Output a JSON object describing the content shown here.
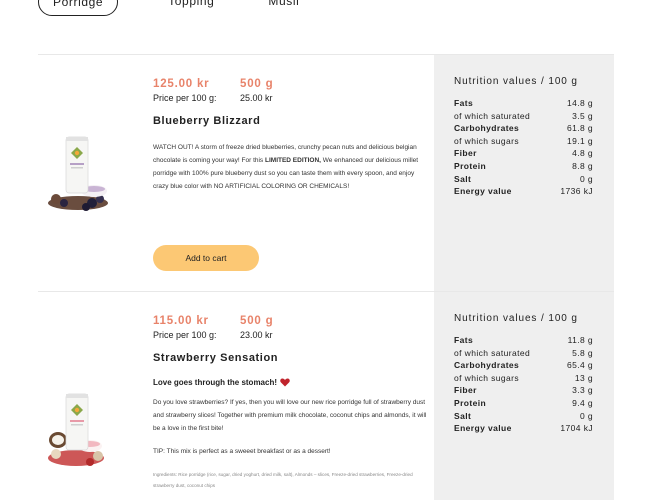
{
  "tabs": [
    {
      "label": "Porridge",
      "active": true
    },
    {
      "label": "Topping",
      "active": false
    },
    {
      "label": "Müsli",
      "active": false
    }
  ],
  "products": [
    {
      "price": "125.00 kr",
      "weight": "500 g",
      "price_per_label": "Price per 100 g:",
      "price_per_value": "25.00 kr",
      "name": "Blueberry Blizzard",
      "description_pre": "WATCH OUT! A storm of freeze dried blueberries, crunchy pecan nuts and delicious belgian chocolate is coming your way! For this ",
      "description_bold": "LIMITED EDITION,",
      "description_post": " We enhanced our delicious millet porridge with 100% pure blueberry dust so you can taste them with every spoon, and enjoy crazy blue color with NO ARTIFICIAL COLORING OR CHEMICALS!",
      "cart_label": "Add to cart",
      "nutrition_title": "Nutrition values / 100 g",
      "nutrition": [
        {
          "label": "Fats",
          "value": "14.8 g",
          "bold": true
        },
        {
          "label": "of which saturated",
          "value": "3.5 g",
          "bold": false
        },
        {
          "label": "Carbohydrates",
          "value": "61.8 g",
          "bold": true
        },
        {
          "label": "of which sugars",
          "value": "19.1 g",
          "bold": false
        },
        {
          "label": "Fiber",
          "value": "4.8 g",
          "bold": true
        },
        {
          "label": "Protein",
          "value": "8.8 g",
          "bold": true
        },
        {
          "label": "Salt",
          "value": "0 g",
          "bold": true
        },
        {
          "label": "Energy value",
          "value": "1736 kJ",
          "bold": true
        }
      ]
    },
    {
      "price": "115.00 kr",
      "weight": "500 g",
      "price_per_label": "Price per 100 g:",
      "price_per_value": "23.00 kr",
      "name": "Strawberry Sensation",
      "tagline": "Love goes through the stomach!",
      "description": "Do you love strawberries? If yes, then you will love our new rice porridge full of strawberry dust and strawberry slices! Together with premium milk chocolate, coconut chips and almonds, it will be a love in the first bite!",
      "tip": "TIP: This mix is perfect as a sweeet breakfast or as a dessert!",
      "ingredients": "Ingredients: Rice porridge (rice, sugar, dried yoghurt, dried milk, salt), Almonds – slices, Freeze-dried strawberries, Freeze-dried strawberry dust, coconut chips",
      "nutrition_title": "Nutrition values / 100 g",
      "nutrition": [
        {
          "label": "Fats",
          "value": "11.8 g",
          "bold": true
        },
        {
          "label": "of which saturated",
          "value": "5.8 g",
          "bold": false
        },
        {
          "label": "Carbohydrates",
          "value": "65.4 g",
          "bold": true
        },
        {
          "label": "of which sugars",
          "value": "13 g",
          "bold": false
        },
        {
          "label": "Fiber",
          "value": "3.3 g",
          "bold": true
        },
        {
          "label": "Protein",
          "value": "9.4 g",
          "bold": true
        },
        {
          "label": "Salt",
          "value": "0 g",
          "bold": true
        },
        {
          "label": "Energy value",
          "value": "1704 kJ",
          "bold": true
        }
      ]
    }
  ],
  "colors": {
    "accent": "#e8836a",
    "button": "#fcc874",
    "panel": "#efefef",
    "vegan": "#3aa35b",
    "heart": "#c0242c"
  }
}
